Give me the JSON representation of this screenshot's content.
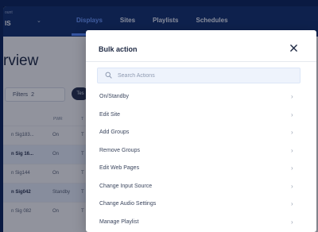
{
  "account": {
    "label": "ount",
    "name": "IS"
  },
  "nav": {
    "tabs": [
      "Displays",
      "Sites",
      "Playlists",
      "Schedules"
    ]
  },
  "page": {
    "title": "rview"
  },
  "filters": {
    "label": "Filters",
    "count": "2",
    "pill": "Tes"
  },
  "table": {
    "headers": {
      "pwr": "PWR",
      "t": "T"
    },
    "rows": [
      {
        "name": "n Sig183...",
        "pwr": "On",
        "t": "T"
      },
      {
        "name": "n Sig 16...",
        "pwr": "On",
        "t": "T"
      },
      {
        "name": "n Sig144",
        "pwr": "On",
        "t": "T"
      },
      {
        "name": "n Sig042",
        "pwr": "Standby",
        "t": "T"
      },
      {
        "name": "n Sig 082",
        "pwr": "On",
        "t": "T"
      }
    ]
  },
  "modal": {
    "title": "Bulk action",
    "search_placeholder": "Search Actions",
    "actions": [
      "On/Standby",
      "Edit Site",
      "Add Groups",
      "Remove Groups",
      "Edit Web Pages",
      "Change Input Source",
      "Change Audio Settings",
      "Manage Playlist",
      ""
    ],
    "chevron": "›"
  },
  "colors": {
    "nav_bg": "#16336f",
    "nav_active": "#6d9bff",
    "search_bg": "#eef3fc",
    "frame_bg": "#0a1a42"
  },
  "icons": {
    "close": "close-icon",
    "search": "search-icon",
    "chevron": "chevron-right-icon",
    "account_chevron": "chevron-down-icon"
  }
}
